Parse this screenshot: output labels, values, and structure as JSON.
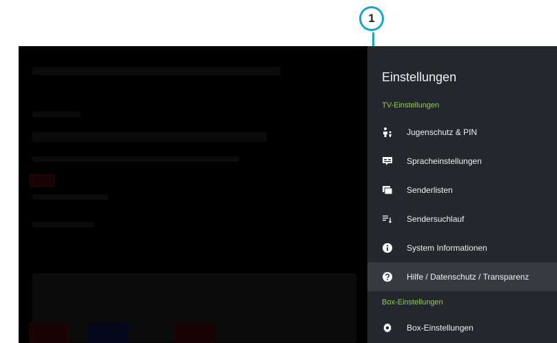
{
  "callout": {
    "number": "1"
  },
  "panel": {
    "title": "Einstellungen",
    "sections": [
      {
        "label": "TV-Einstellungen"
      },
      {
        "label": "Box-Einstellungen"
      }
    ],
    "items": [
      {
        "label": "Jugenschutz & PIN",
        "icon": "parental-control-icon"
      },
      {
        "label": "Spracheinstellungen",
        "icon": "subtitles-icon"
      },
      {
        "label": "Senderlisten",
        "icon": "channel-list-icon"
      },
      {
        "label": "Sendersuchlauf",
        "icon": "channel-scan-icon"
      },
      {
        "label": "System Informationen",
        "icon": "info-icon"
      },
      {
        "label": "Hilfe / Datenschutz / Transparenz",
        "icon": "help-icon"
      },
      {
        "label": "Box-Einstellungen",
        "icon": "gear-icon"
      }
    ]
  },
  "colors": {
    "accent_green": "#8fd14f",
    "callout_blue": "#1aa3c9",
    "panel_bg": "#24272b"
  }
}
